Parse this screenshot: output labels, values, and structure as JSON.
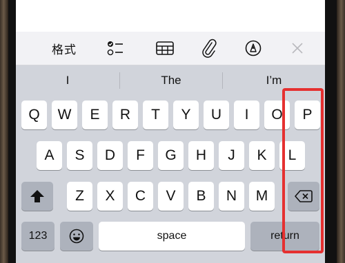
{
  "toolbar": {
    "format_label": "格式",
    "icons": [
      "checklist-icon",
      "table-icon",
      "paperclip-icon",
      "markup-pen-icon",
      "close-icon"
    ]
  },
  "suggestions": [
    "I",
    "The",
    "I’m"
  ],
  "keyboard": {
    "row1": [
      "Q",
      "W",
      "E",
      "R",
      "T",
      "Y",
      "U",
      "I",
      "O",
      "P"
    ],
    "row2": [
      "A",
      "S",
      "D",
      "F",
      "G",
      "H",
      "J",
      "K",
      "L"
    ],
    "row3": [
      "Z",
      "X",
      "C",
      "V",
      "B",
      "N",
      "M"
    ],
    "numbers_label": "123",
    "space_label": "space",
    "return_label": "return"
  },
  "colors": {
    "highlight": "#e53030",
    "keyboard_bg": "#d1d4db"
  }
}
